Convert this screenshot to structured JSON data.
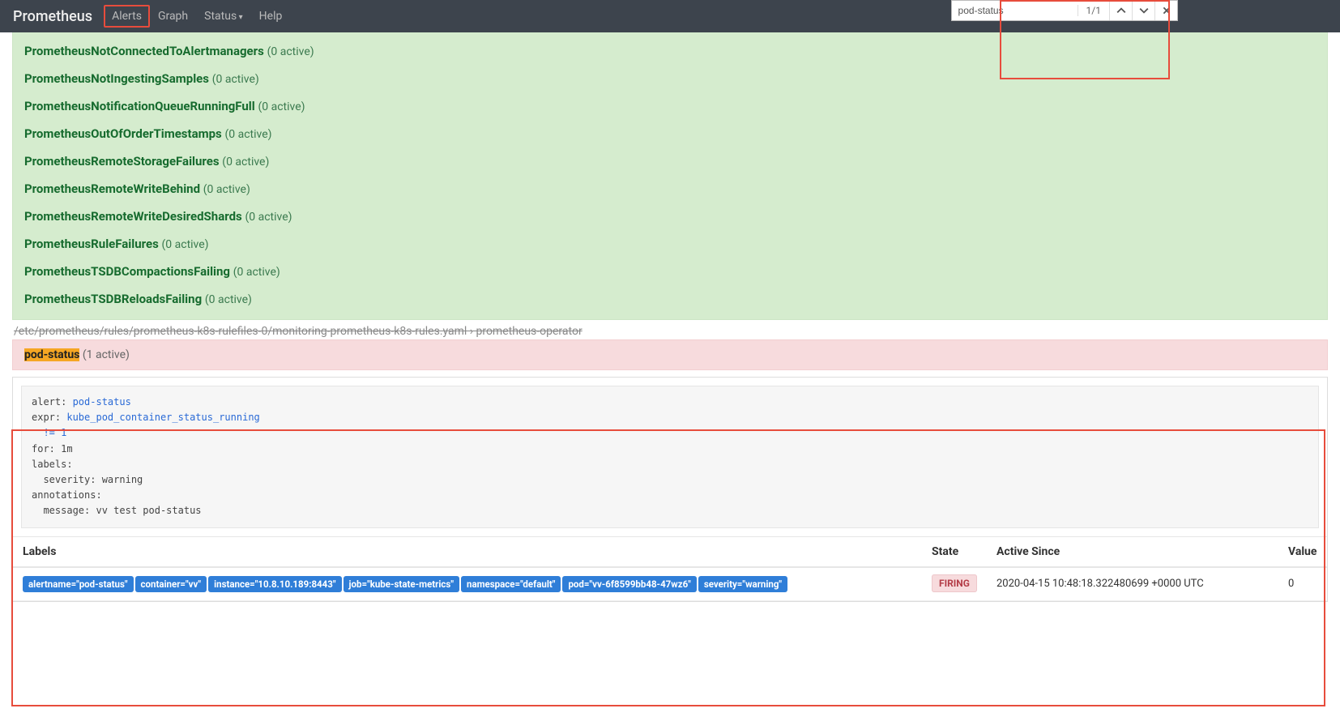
{
  "nav": {
    "brand": "Prometheus",
    "items": [
      "Alerts",
      "Graph",
      "Status",
      "Help"
    ]
  },
  "find": {
    "value": "pod-status",
    "count": "1/1"
  },
  "inactiveAlerts": [
    {
      "name": "PrometheusNotConnectedToAlertmanagers",
      "count": "(0 active)"
    },
    {
      "name": "PrometheusNotIngestingSamples",
      "count": "(0 active)"
    },
    {
      "name": "PrometheusNotificationQueueRunningFull",
      "count": "(0 active)"
    },
    {
      "name": "PrometheusOutOfOrderTimestamps",
      "count": "(0 active)"
    },
    {
      "name": "PrometheusRemoteStorageFailures",
      "count": "(0 active)"
    },
    {
      "name": "PrometheusRemoteWriteBehind",
      "count": "(0 active)"
    },
    {
      "name": "PrometheusRemoteWriteDesiredShards",
      "count": "(0 active)"
    },
    {
      "name": "PrometheusRuleFailures",
      "count": "(0 active)"
    },
    {
      "name": "PrometheusTSDBCompactionsFailing",
      "count": "(0 active)"
    },
    {
      "name": "PrometheusTSDBReloadsFailing",
      "count": "(0 active)"
    }
  ],
  "rulePath": "/etc/prometheus/rules/prometheus-k8s-rulefiles-0/monitoring-prometheus-k8s-rules.yaml › prometheus-operator",
  "firingAlert": {
    "name": "pod-status",
    "count": "(1 active)",
    "code_alert_key": "alert: ",
    "code_alert_val": "pod-status",
    "code_expr_key": "expr: ",
    "code_expr_val": "kube_pod_container_status_running",
    "code_expr_cont": "  != 1",
    "code_for": "for: 1m",
    "code_labels": "labels:",
    "code_severity": "  severity: warning",
    "code_annotations": "annotations:",
    "code_message": "  message: vv test pod-status"
  },
  "table": {
    "headers": {
      "labels": "Labels",
      "state": "State",
      "since": "Active Since",
      "value": "Value"
    },
    "row": {
      "labels": [
        "alertname=\"pod-status\"",
        "container=\"vv\"",
        "instance=\"10.8.10.189:8443\"",
        "job=\"kube-state-metrics\"",
        "namespace=\"default\"",
        "pod=\"vv-6f8599bb48-47wz6\"",
        "severity=\"warning\""
      ],
      "state": "FIRING",
      "since": "2020-04-15 10:48:18.322480699 +0000 UTC",
      "value": "0"
    }
  }
}
